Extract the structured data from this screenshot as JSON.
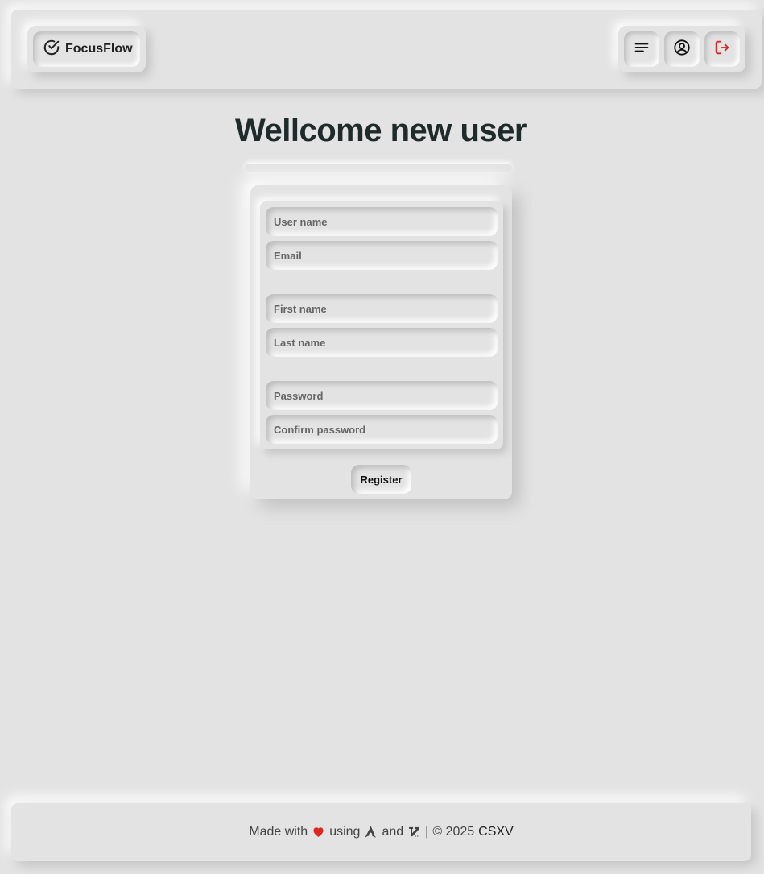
{
  "header": {
    "brand": "FocusFlow",
    "buttons": [
      {
        "name": "menu",
        "icon": "menu-lines-icon"
      },
      {
        "name": "profile",
        "icon": "user-circle-icon"
      },
      {
        "name": "logout",
        "icon": "logout-icon",
        "color": "#e02424"
      }
    ]
  },
  "page": {
    "title": "Wellcome new user"
  },
  "form": {
    "username_placeholder": "User name",
    "email_placeholder": "Email",
    "firstname_placeholder": "First name",
    "lastname_placeholder": "Last name",
    "password_placeholder": "Password",
    "confirm_password_placeholder": "Confirm password",
    "register_label": "Register"
  },
  "footer": {
    "made_with": "Made with",
    "using": "using",
    "and": "and",
    "separator": "|",
    "copyright": "© 2025",
    "author": "CSXV",
    "heart_color": "#e02424",
    "icons": [
      "heart-icon",
      "arch-logo-icon",
      "vim-logo-icon"
    ]
  }
}
